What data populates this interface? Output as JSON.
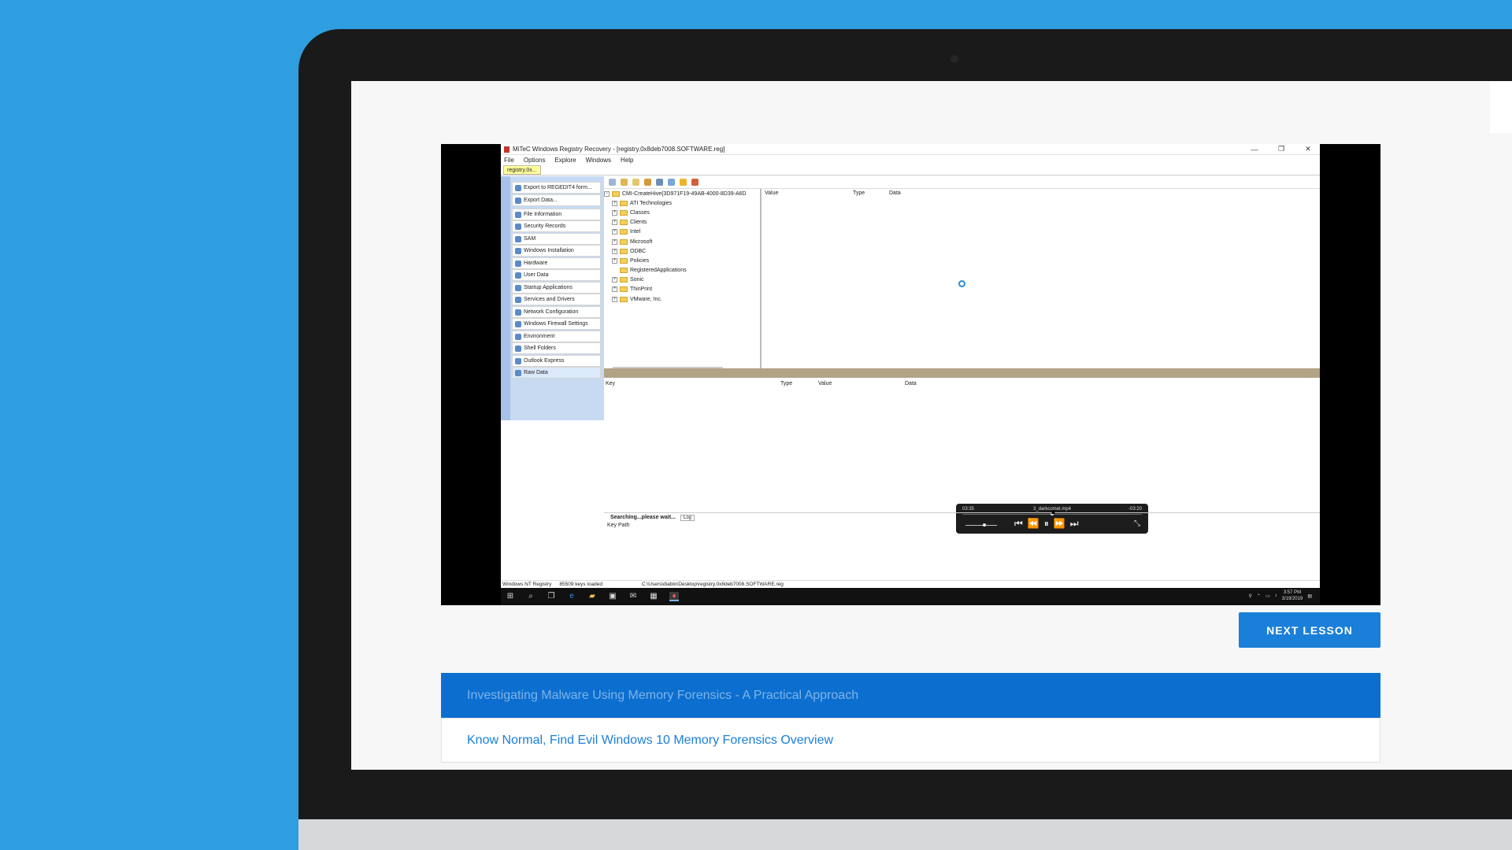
{
  "registry_app": {
    "window_title": "MiTeC Windows Registry Recovery - [registry.0x8deb7008.SOFTWARE.reg]",
    "window_buttons": [
      "—",
      "❐",
      "✕"
    ],
    "menu": [
      "File",
      "Options",
      "Explore",
      "Windows",
      "Help"
    ],
    "doc_tab": "registry.0x...",
    "tasks": [
      {
        "label": "Export to REGEDIT4 form...",
        "icon": "export-icon"
      },
      {
        "label": "Export Data...",
        "icon": "export-data-icon"
      },
      {
        "label": "File Information",
        "icon": "info-icon"
      },
      {
        "label": "Security Records",
        "icon": "security-icon"
      },
      {
        "label": "SAM",
        "icon": "sam-icon"
      },
      {
        "label": "Windows Installation",
        "icon": "windows-icon"
      },
      {
        "label": "Hardware",
        "icon": "hardware-icon"
      },
      {
        "label": "User Data",
        "icon": "user-icon"
      },
      {
        "label": "Startup Applications",
        "icon": "startup-icon"
      },
      {
        "label": "Services and Drivers",
        "icon": "services-icon"
      },
      {
        "label": "Network Configuration",
        "icon": "network-icon"
      },
      {
        "label": "Windows Firewall Settings",
        "icon": "firewall-icon"
      },
      {
        "label": "Environment",
        "icon": "environment-icon"
      },
      {
        "label": "Shell Folders",
        "icon": "folder-icon"
      },
      {
        "label": "Outlook Express",
        "icon": "outlook-icon"
      },
      {
        "label": "Raw Data",
        "icon": "raw-data-icon"
      }
    ],
    "tree_root": "CMI-CreateHive{3D971F19-49AB-4000-8D39-A6D",
    "tree_items": [
      "ATI Technologies",
      "Classes",
      "Clients",
      "Intel",
      "Microsoft",
      "ODBC",
      "Policies",
      "RegisteredApplications",
      "Sonic",
      "ThinPrint",
      "VMware, Inc."
    ],
    "value_columns": [
      "Value",
      "Type",
      "Data"
    ],
    "key_columns": [
      "Key",
      "Type",
      "Value",
      "Data"
    ],
    "search_status": "Searching...please wait...",
    "log_tab": "Log",
    "key_path_label": "Key Path",
    "status_os": "Windows NT Registry",
    "status_keys": "85509 keys loaded",
    "status_path": "C:\\Users\\diablo\\Desktop\\registry.0x8deb7008.SOFTWARE.reg"
  },
  "video_controls": {
    "elapsed": "03:35",
    "filename": "3_darkcomet.mp4",
    "remaining": "-03:20",
    "progress": 0.5
  },
  "taskbar": {
    "time": "3:57 PM",
    "date": "3/19/2019"
  },
  "lesson_nav": {
    "next_button": "NEXT LESSON",
    "lessons": [
      {
        "title": "Investigating Malware Using Memory Forensics - A Practical Approach",
        "active": true
      },
      {
        "title": "Know Normal, Find Evil Windows 10 Memory Forensics Overview",
        "active": false
      }
    ]
  },
  "colors": {
    "background": "#2f9ee0",
    "accent": "#1a7fd9",
    "active_lesson": "#0c6fd0"
  }
}
